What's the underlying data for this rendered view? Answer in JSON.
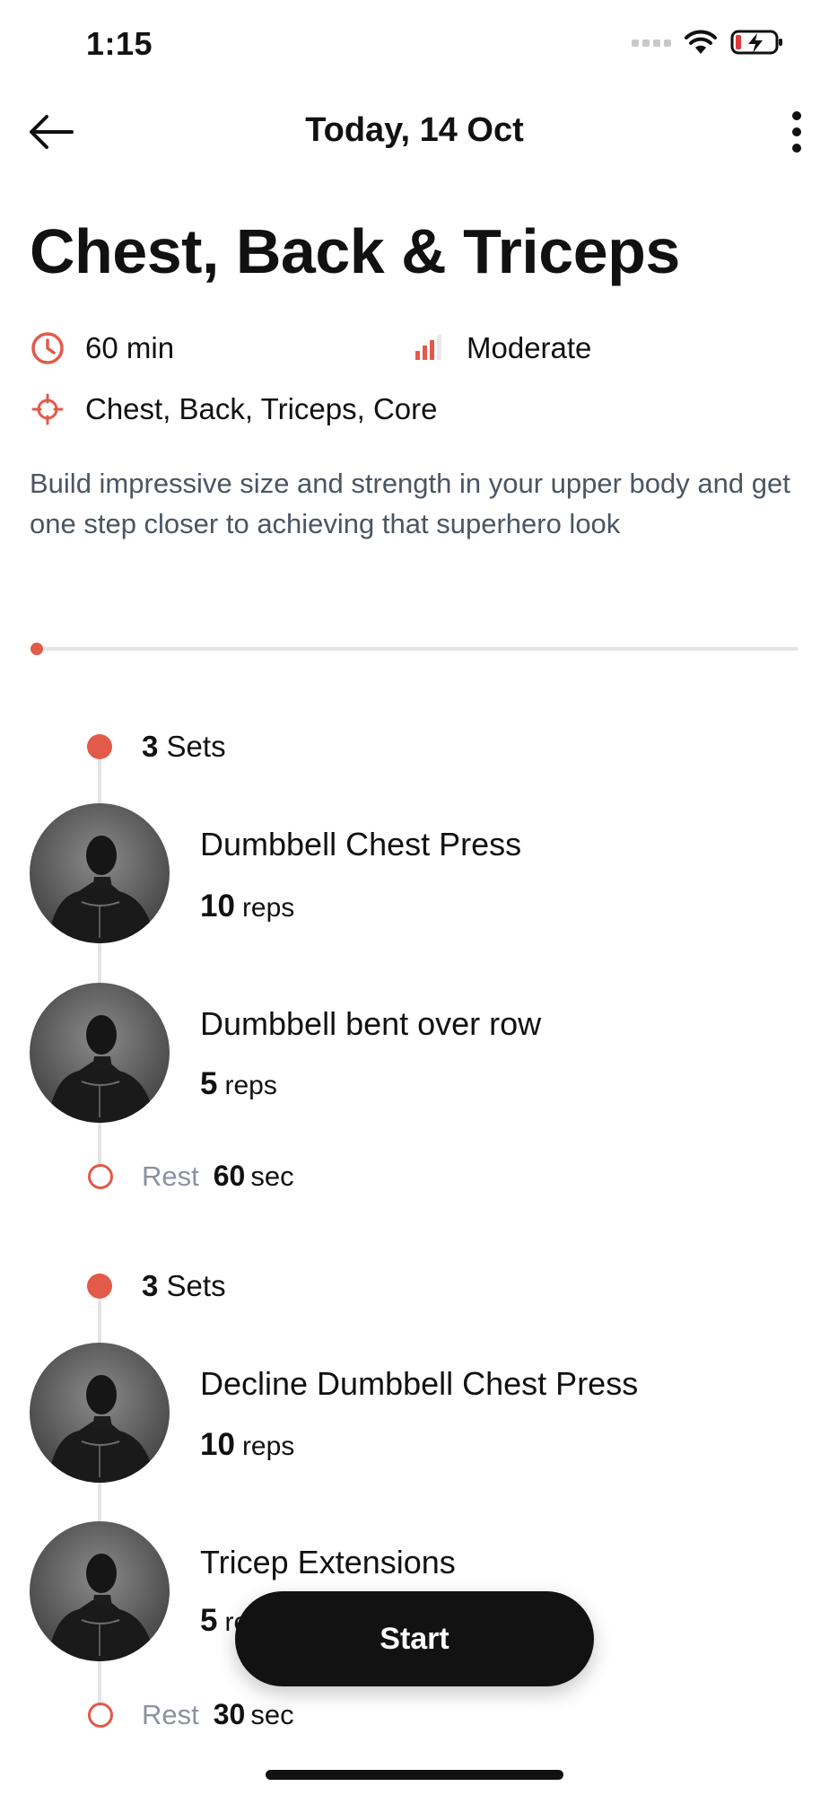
{
  "status_bar": {
    "time": "1:15"
  },
  "header": {
    "title": "Today, 14 Oct"
  },
  "workout": {
    "title": "Chest, Back & Triceps",
    "duration": "60 min",
    "difficulty": "Moderate",
    "targets": "Chest, Back, Triceps, Core",
    "description": "Build impressive size and strength in your upper body and get one step closer to achieving that superhero look",
    "progress": 0
  },
  "sets_label": "Sets",
  "reps_label": "reps",
  "rest_label": "Rest",
  "sec_label": "sec",
  "groups": [
    {
      "sets": "3",
      "exercises": [
        {
          "name": "Dumbbell Chest Press",
          "reps": "10"
        },
        {
          "name": "Dumbbell bent over row",
          "reps": "5"
        }
      ],
      "rest": "60"
    },
    {
      "sets": "3",
      "exercises": [
        {
          "name": "Decline Dumbbell Chest Press",
          "reps": "10"
        },
        {
          "name": "Tricep Extensions",
          "reps": "5"
        }
      ],
      "rest": "30"
    }
  ],
  "start_button": "Start",
  "colors": {
    "accent": "#e25a48",
    "button": "#121212",
    "muted_text": "#4b5563"
  },
  "icons": [
    "back-arrow-icon",
    "more-vertical-icon",
    "clock-icon",
    "signal-bars-icon",
    "crosshair-icon",
    "wifi-icon",
    "battery-charging-icon",
    "cellular-icon"
  ]
}
